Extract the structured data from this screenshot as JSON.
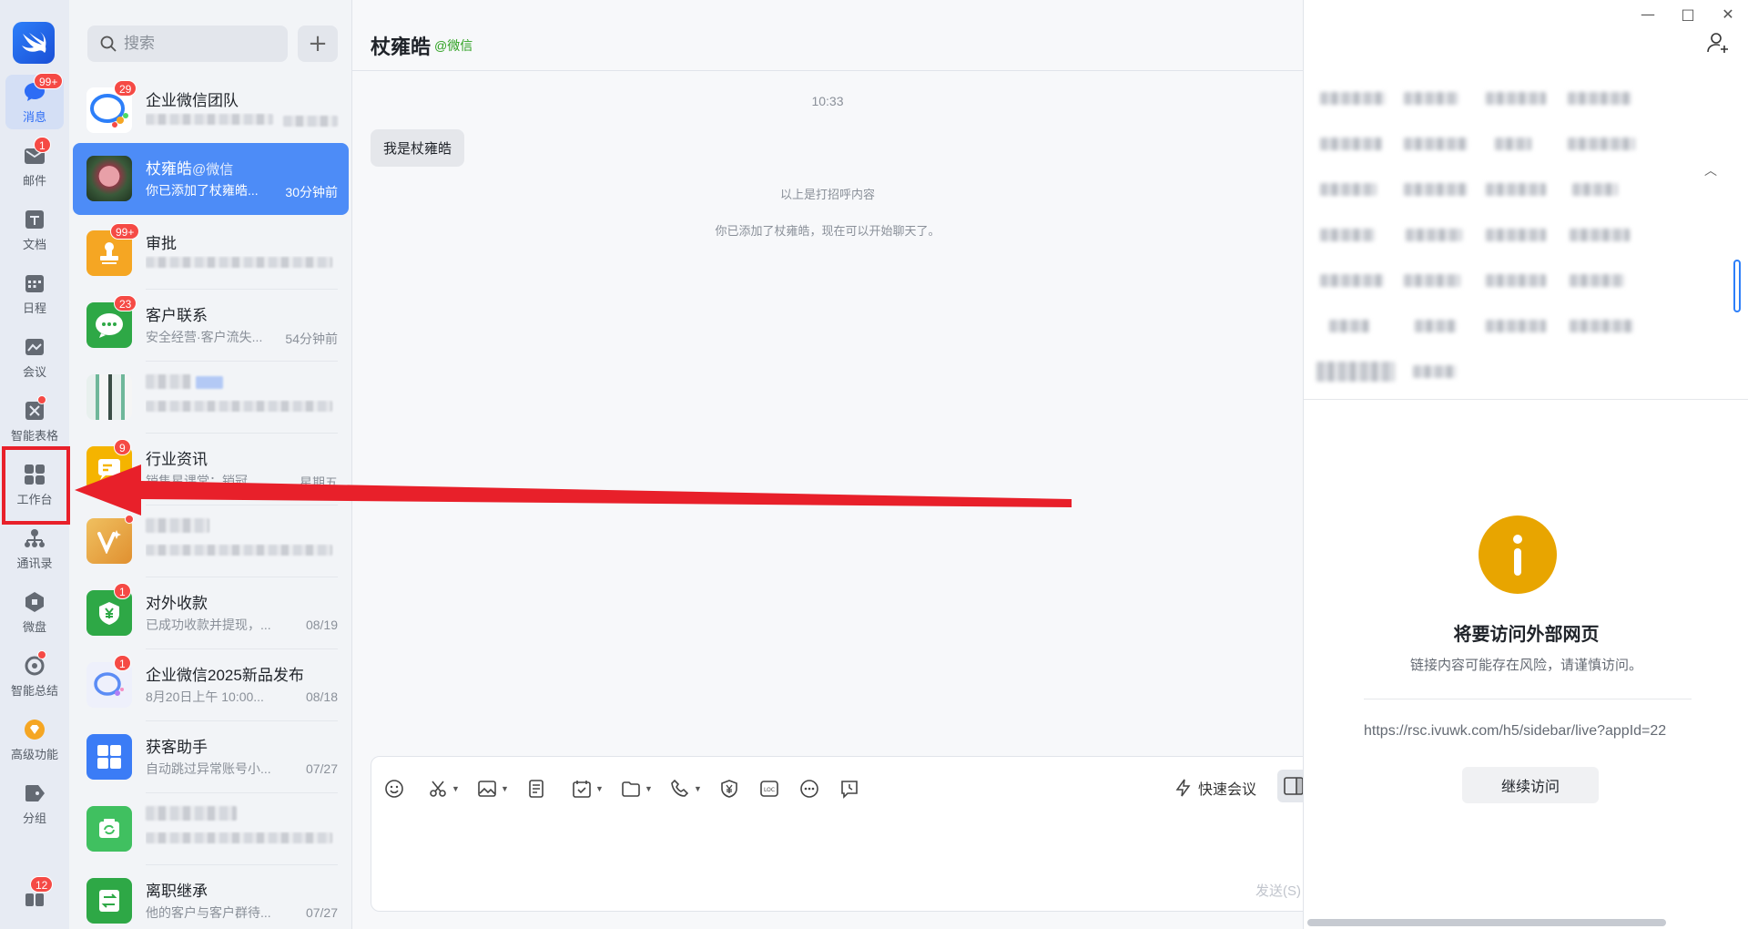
{
  "rail": {
    "items": [
      {
        "id": "messages",
        "label": "消息",
        "badge": "99+",
        "active": true
      },
      {
        "id": "mail",
        "label": "邮件",
        "badge": "1"
      },
      {
        "id": "docs",
        "label": "文档"
      },
      {
        "id": "calendar",
        "label": "日程"
      },
      {
        "id": "meeting",
        "label": "会议"
      },
      {
        "id": "smart-sheet",
        "label": "智能表格",
        "dot": true
      },
      {
        "id": "workbench",
        "label": "工作台"
      },
      {
        "id": "contacts",
        "label": "通讯录"
      },
      {
        "id": "drive",
        "label": "微盘"
      },
      {
        "id": "smart-summary",
        "label": "智能总结",
        "dot": true
      },
      {
        "id": "advanced",
        "label": "高级功能"
      },
      {
        "id": "groups",
        "label": "分组"
      }
    ],
    "bottom_badge": "12"
  },
  "search": {
    "placeholder": "搜索"
  },
  "conversations": [
    {
      "name": "企业微信团队",
      "badge": "29",
      "preview": "",
      "time": ""
    },
    {
      "name": "杖雍皓",
      "tag": "@微信",
      "preview": "你已添加了杖雍皓...",
      "time": "30分钟前",
      "active": true
    },
    {
      "name": "审批",
      "badge": "99+",
      "preview": "",
      "time": ""
    },
    {
      "name": "客户联系",
      "badge": "23",
      "preview": "安全经营·客户流失...",
      "time": "54分钟前"
    },
    {
      "name": "",
      "preview": "",
      "time": ""
    },
    {
      "name": "行业资讯",
      "badge": "9",
      "preview": "销售星课堂：销冠说...",
      "time": "星期五"
    },
    {
      "name": "",
      "preview": "",
      "time": "",
      "dot": true
    },
    {
      "name": "对外收款",
      "badge": "1",
      "preview": "已成功收款并提现，...",
      "time": "08/19"
    },
    {
      "name": "企业微信2025新品发布",
      "badge": "1",
      "preview": "8月20日上午 10:00...",
      "time": "08/18"
    },
    {
      "name": "获客助手",
      "preview": "自动跳过异常账号小...",
      "time": "07/27"
    },
    {
      "name": "",
      "preview": "",
      "time": ""
    },
    {
      "name": "离职继承",
      "preview": "他的客户与客户群待...",
      "time": "07/27"
    }
  ],
  "chat": {
    "title": "杖雍皓",
    "source": "@微信",
    "timestamp": "10:33",
    "bubble": "我是杖雍皓",
    "system_1": "以上是打招呼内容",
    "system_2": "你已添加了杖雍皓，现在可以开始聊天了。"
  },
  "composer": {
    "quick_meeting": "快速会议",
    "send": "发送(S)"
  },
  "panel": {
    "warning_title": "将要访问外部网页",
    "warning_sub": "链接内容可能存在风险，请谨慎访问。",
    "url": "https://rsc.ivuwk.com/h5/sidebar/live?appId=22",
    "continue": "继续访问"
  },
  "colors": {
    "accent": "#4d8cf7",
    "badge": "#f54a45",
    "highlight": "#e8202a",
    "warning": "#e8a500"
  }
}
